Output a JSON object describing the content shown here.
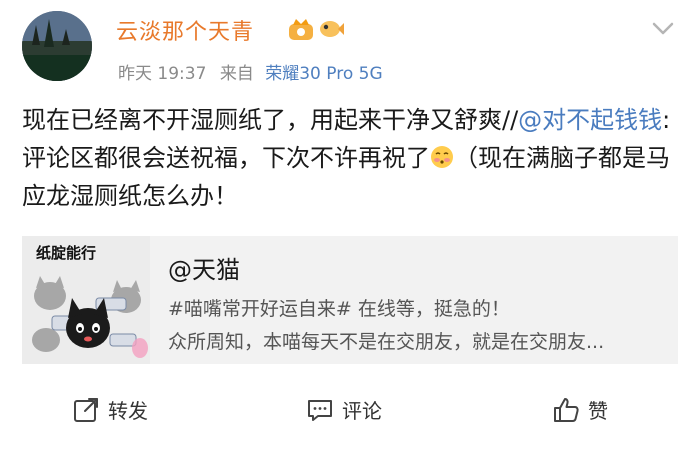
{
  "post": {
    "username": "云淡那个天青",
    "time": "昨天 19:37",
    "source_prefix": "来自",
    "device": "荣耀30 Pro 5G",
    "text_part1": "现在已经离不开湿厕纸了，用起来干净又舒爽//",
    "mention": "@对不起钱钱",
    "text_part2": ":评论区都很会送祝福，下次不许再祝了",
    "text_part3": "（现在满脑子都是马应龙湿厕纸怎么办！"
  },
  "card": {
    "thumb_title": "纸腚能行",
    "title": "@天猫",
    "line1": "#喵嘴常开好运自来# 在线等，挺急的！",
    "line2": "众所周知，本喵每天不是在交朋友，就是在交朋友..."
  },
  "actions": {
    "repost_label": "转发",
    "comment_label": "评论",
    "like_label": "赞"
  },
  "colors": {
    "username": "#e8792b",
    "mention": "#4a7cbf",
    "device": "#4f7fbf"
  },
  "icons": [
    "avatar-image",
    "vip-crown-icon",
    "fish-badge-icon",
    "chevron-down-icon",
    "blush-emoji",
    "repost-icon",
    "comment-icon",
    "like-icon"
  ]
}
